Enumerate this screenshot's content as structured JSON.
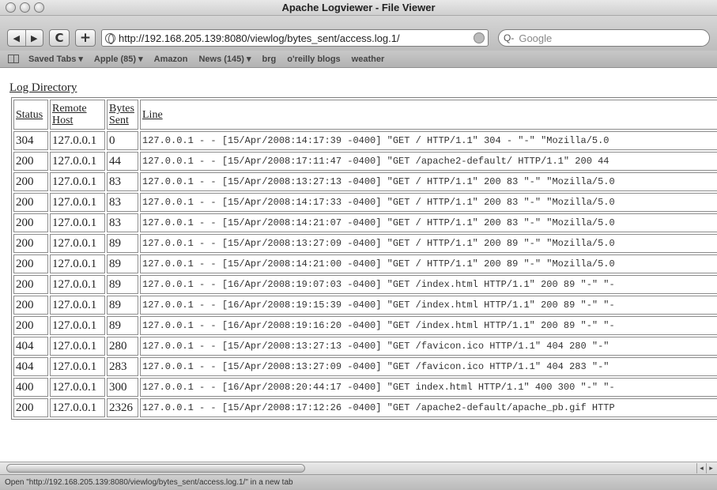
{
  "window": {
    "title": "Apache Logviewer - File Viewer"
  },
  "toolbar": {
    "back_icon": "back-arrow-icon",
    "forward_icon": "forward-arrow-icon",
    "back_glyph": "◀",
    "forward_glyph": "▶",
    "reload_glyph": "C",
    "add_glyph": "+",
    "url": "http://192.168.205.139:8080/viewlog/bytes_sent/access.log.1/",
    "search_placeholder": "Google",
    "search_glyph": "Q-"
  },
  "bookmarks": [
    "Saved Tabs ▾",
    "Apple (85) ▾",
    "Amazon",
    "News (145) ▾",
    "brg",
    "o'reilly blogs",
    "weather"
  ],
  "page": {
    "directory_link": "Log Directory",
    "columns": {
      "status": "Status",
      "host_1": "Remote",
      "host_2": "Host",
      "bytes_1": "Bytes",
      "bytes_2": "Sent",
      "line": "Line"
    },
    "rows": [
      {
        "status": "304",
        "host": "127.0.0.1",
        "bytes": "0",
        "line": "127.0.0.1 - - [15/Apr/2008:14:17:39 -0400] \"GET / HTTP/1.1\" 304 - \"-\" \"Mozilla/5.0"
      },
      {
        "status": "200",
        "host": "127.0.0.1",
        "bytes": "44",
        "line": "127.0.0.1 - - [15/Apr/2008:17:11:47 -0400] \"GET /apache2-default/ HTTP/1.1\" 200 44"
      },
      {
        "status": "200",
        "host": "127.0.0.1",
        "bytes": "83",
        "line": "127.0.0.1 - - [15/Apr/2008:13:27:13 -0400] \"GET / HTTP/1.1\" 200 83 \"-\" \"Mozilla/5.0"
      },
      {
        "status": "200",
        "host": "127.0.0.1",
        "bytes": "83",
        "line": "127.0.0.1 - - [15/Apr/2008:14:17:33 -0400] \"GET / HTTP/1.1\" 200 83 \"-\" \"Mozilla/5.0"
      },
      {
        "status": "200",
        "host": "127.0.0.1",
        "bytes": "83",
        "line": "127.0.0.1 - - [15/Apr/2008:14:21:07 -0400] \"GET / HTTP/1.1\" 200 83 \"-\" \"Mozilla/5.0"
      },
      {
        "status": "200",
        "host": "127.0.0.1",
        "bytes": "89",
        "line": "127.0.0.1 - - [15/Apr/2008:13:27:09 -0400] \"GET / HTTP/1.1\" 200 89 \"-\" \"Mozilla/5.0"
      },
      {
        "status": "200",
        "host": "127.0.0.1",
        "bytes": "89",
        "line": "127.0.0.1 - - [15/Apr/2008:14:21:00 -0400] \"GET / HTTP/1.1\" 200 89 \"-\" \"Mozilla/5.0"
      },
      {
        "status": "200",
        "host": "127.0.0.1",
        "bytes": "89",
        "line": "127.0.0.1 - - [16/Apr/2008:19:07:03 -0400] \"GET /index.html HTTP/1.1\" 200 89 \"-\" \"-"
      },
      {
        "status": "200",
        "host": "127.0.0.1",
        "bytes": "89",
        "line": "127.0.0.1 - - [16/Apr/2008:19:15:39 -0400] \"GET /index.html HTTP/1.1\" 200 89 \"-\" \"-"
      },
      {
        "status": "200",
        "host": "127.0.0.1",
        "bytes": "89",
        "line": "127.0.0.1 - - [16/Apr/2008:19:16:20 -0400] \"GET /index.html HTTP/1.1\" 200 89 \"-\" \"-"
      },
      {
        "status": "404",
        "host": "127.0.0.1",
        "bytes": "280",
        "line": "127.0.0.1 - - [15/Apr/2008:13:27:13 -0400] \"GET /favicon.ico HTTP/1.1\" 404 280 \"-\""
      },
      {
        "status": "404",
        "host": "127.0.0.1",
        "bytes": "283",
        "line": "127.0.0.1 - - [15/Apr/2008:13:27:09 -0400] \"GET /favicon.ico HTTP/1.1\" 404 283 \"-\""
      },
      {
        "status": "400",
        "host": "127.0.0.1",
        "bytes": "300",
        "line": "127.0.0.1 - - [16/Apr/2008:20:44:17 -0400] \"GET index.html HTTP/1.1\" 400 300 \"-\" \"-"
      },
      {
        "status": "200",
        "host": "127.0.0.1",
        "bytes": "2326",
        "line": "127.0.0.1 - - [15/Apr/2008:17:12:26 -0400] \"GET /apache2-default/apache_pb.gif HTTP"
      }
    ]
  },
  "scrollbar": {
    "left_glyph": "◂",
    "right_glyph": "▸"
  },
  "statusbar": {
    "text": "Open \"http://192.168.205.139:8080/viewlog/bytes_sent/access.log.1/\" in a new tab"
  }
}
